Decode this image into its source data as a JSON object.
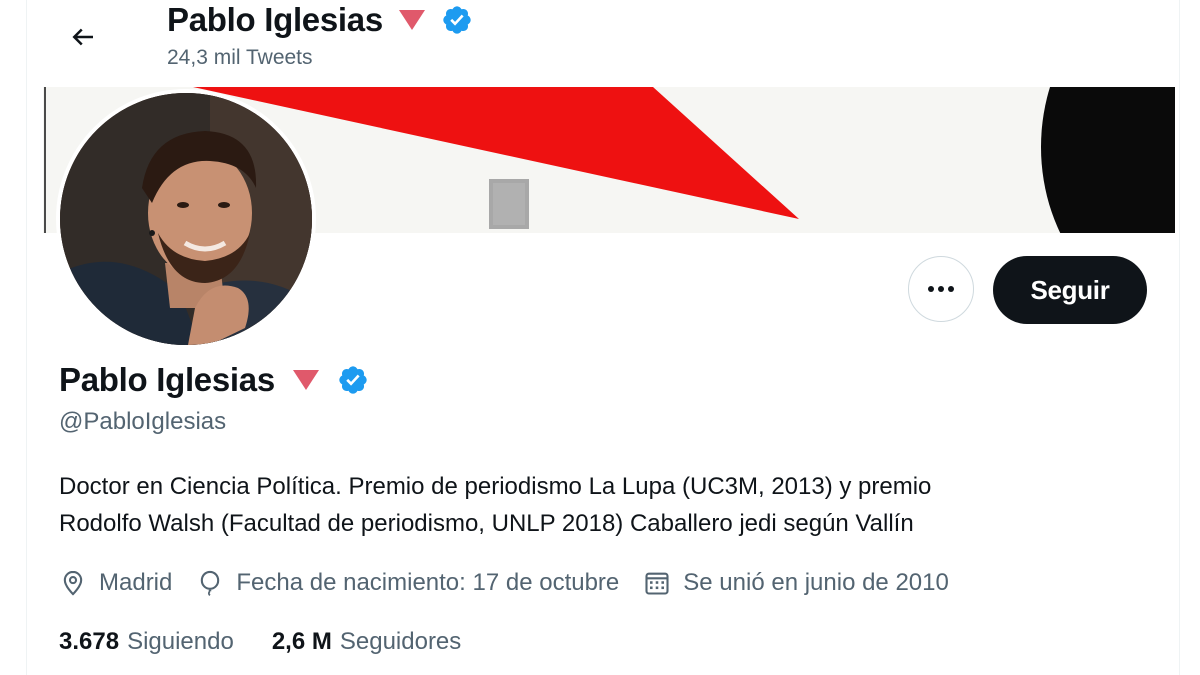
{
  "header": {
    "name": "Pablo Iglesias",
    "tweet_count": "24,3 mil Tweets"
  },
  "profile": {
    "name": "Pablo Iglesias",
    "handle": "@PabloIglesias",
    "bio_line1": "Doctor en Ciencia Política. Premio de periodismo La Lupa (UC3M, 2013) y premio",
    "bio_line2": "Rodolfo Walsh (Facultad de periodismo, UNLP 2018) Caballero jedi según Vallín",
    "location": "Madrid",
    "birthday": "Fecha de nacimiento: 17 de octubre",
    "joined": "Se unió en junio de 2010"
  },
  "actions": {
    "follow_label": "Seguir"
  },
  "stats": {
    "following_value": "3.678",
    "following_label": "Siguiendo",
    "followers_value": "2,6 M",
    "followers_label": "Seguidores"
  },
  "icons": {
    "back": "arrow-left-icon",
    "name_emoji": "red-triangle-down-icon",
    "verified": "verified-badge-icon",
    "more": "more-horizontal-icon",
    "location": "location-pin-icon",
    "birthday": "balloon-icon",
    "joined": "calendar-icon"
  },
  "colors": {
    "verified_blue": "#1d9bf0",
    "triangle_red": "#e0596b",
    "follow_bg": "#0f1419",
    "secondary_text": "#536471"
  }
}
